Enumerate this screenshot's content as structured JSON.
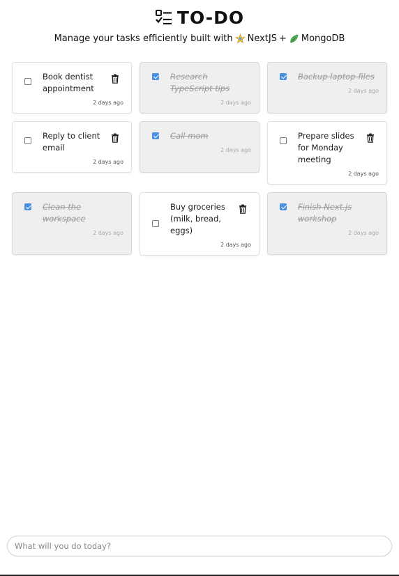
{
  "header": {
    "title": "TO-DO",
    "subtitle_prefix": "Manage your tasks efficiently built with",
    "subtitle_tech1": "NextJS",
    "subtitle_plus": "+",
    "subtitle_tech2": "MongoDB",
    "logo_icon": "checklist-icon"
  },
  "tasks": [
    {
      "text": "Book dentist appointment",
      "time": "2 days ago",
      "done": false
    },
    {
      "text": "Research TypeScript tips",
      "time": "2 days ago",
      "done": true
    },
    {
      "text": "Backup laptop files",
      "time": "2 days ago",
      "done": true
    },
    {
      "text": "Reply to client email",
      "time": "2 days ago",
      "done": false
    },
    {
      "text": "Call mom",
      "time": "2 days ago",
      "done": true
    },
    {
      "text": "Prepare slides for Monday meeting",
      "time": "2 days ago",
      "done": false
    },
    {
      "text": "Clean the workspace",
      "time": "2 days ago",
      "done": true
    },
    {
      "text": "Buy groceries (milk, bread, eggs)",
      "time": "2 days ago",
      "done": false
    },
    {
      "text": "Finish Next.js workshop",
      "time": "2 days ago",
      "done": true
    }
  ],
  "new_task": {
    "placeholder": "What will you do today?",
    "value": ""
  },
  "colors": {
    "checkbox_checked": "#4a90e2",
    "done_card_bg": "#efefef"
  }
}
